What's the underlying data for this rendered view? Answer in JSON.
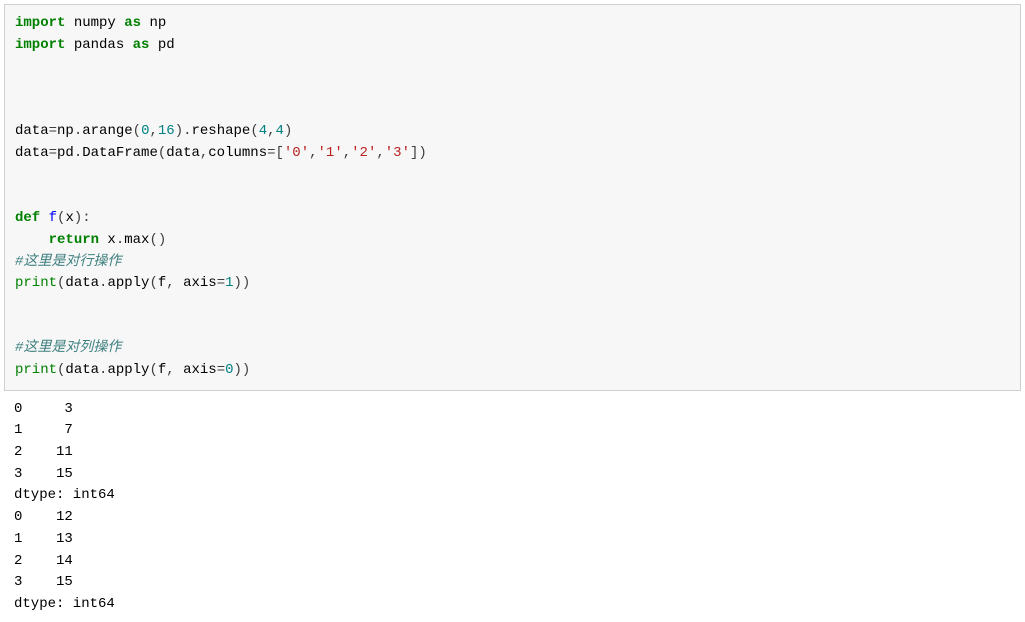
{
  "code": {
    "import1_kw": "import",
    "import1_mod": " numpy ",
    "import1_as": "as",
    "import1_alias": " np",
    "import2_kw": "import",
    "import2_mod": " pandas ",
    "import2_as": "as",
    "import2_alias": " pd",
    "blank2": "\n\n",
    "line3_a": "data",
    "line3_eq": "=",
    "line3_b": "np",
    "line3_dot1": ".",
    "line3_c": "arange",
    "line3_p1": "(",
    "line3_n0": "0",
    "line3_comma1": ",",
    "line3_n16": "16",
    "line3_p2": ").",
    "line3_d": "reshape",
    "line3_p3": "(",
    "line3_n4a": "4",
    "line3_comma2": ",",
    "line3_n4b": "4",
    "line3_p4": ")",
    "line4_a": "data",
    "line4_eq": "=",
    "line4_b": "pd",
    "line4_dot1": ".",
    "line4_c": "DataFrame",
    "line4_p1": "(",
    "line4_d": "data",
    "line4_comma1": ",",
    "line4_e": "columns",
    "line4_eq2": "=[",
    "line4_s0": "'0'",
    "line4_comma2": ",",
    "line4_s1": "'1'",
    "line4_comma3": ",",
    "line4_s2": "'2'",
    "line4_comma4": ",",
    "line4_s3": "'3'",
    "line4_p2": "])",
    "blank1": "\n",
    "def_kw": "def",
    "def_name": " f",
    "def_p1": "(",
    "def_arg": "x",
    "def_p2": "):",
    "ret_indent": "    ",
    "ret_kw": "return",
    "ret_expr_a": " x",
    "ret_dot": ".",
    "ret_expr_b": "max",
    "ret_p": "()",
    "comment1": "#这里是对行操作",
    "print1_a": "print",
    "print1_p1": "(",
    "print1_b": "data",
    "print1_dot": ".",
    "print1_c": "apply",
    "print1_p2": "(",
    "print1_d": "f",
    "print1_comma": ", ",
    "print1_e": "axis",
    "print1_eq": "=",
    "print1_n": "1",
    "print1_p3": "))",
    "comment2": "#这里是对列操作",
    "print2_a": "print",
    "print2_p1": "(",
    "print2_b": "data",
    "print2_dot": ".",
    "print2_c": "apply",
    "print2_p2": "(",
    "print2_d": "f",
    "print2_comma": ", ",
    "print2_e": "axis",
    "print2_eq": "=",
    "print2_n": "0",
    "print2_p3": "))"
  },
  "output": {
    "line1": "0     3",
    "line2": "1     7",
    "line3": "2    11",
    "line4": "3    15",
    "line5": "dtype: int64",
    "line6": "0    12",
    "line7": "1    13",
    "line8": "2    14",
    "line9": "3    15",
    "line10": "dtype: int64"
  }
}
